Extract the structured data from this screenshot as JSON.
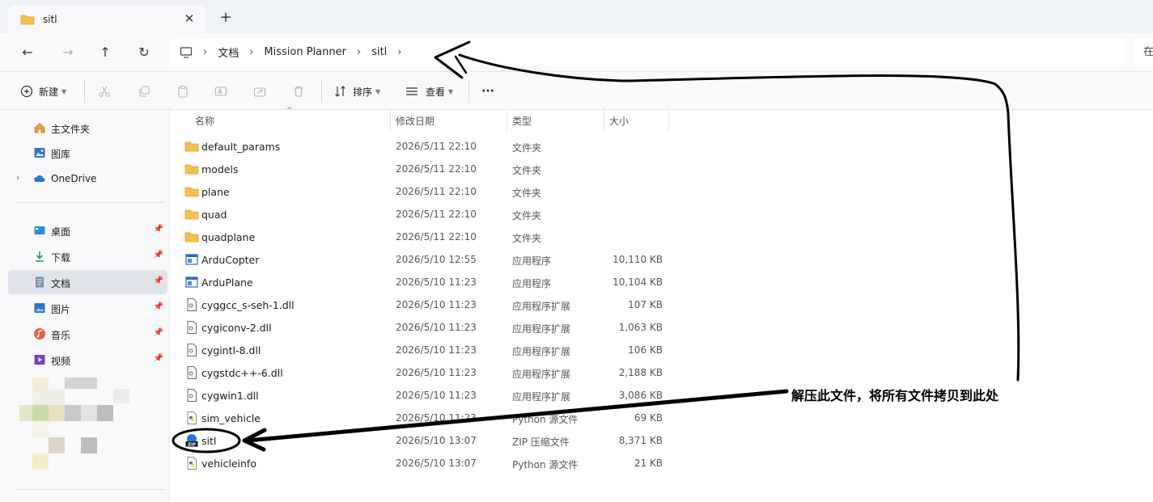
{
  "tab": {
    "title": "sitl",
    "close": "✕",
    "new_tab": "+"
  },
  "nav": {
    "back": "←",
    "forward": "→",
    "up": "↑",
    "refresh": "↻"
  },
  "address": {
    "crumbs": [
      "文档",
      "Mission Planner",
      "sitl"
    ],
    "separator": "›",
    "search_placeholder": "在"
  },
  "toolbar": {
    "new_label": "新建",
    "sort_label": "排序",
    "view_label": "查看",
    "more_label": "···"
  },
  "sidebar": {
    "items": [
      {
        "label": "主文件夹",
        "icon": "home-icon"
      },
      {
        "label": "图库",
        "icon": "gallery-icon"
      },
      {
        "label": "OneDrive",
        "icon": "cloud-icon"
      },
      {
        "label": "桌面",
        "icon": "desktop-icon",
        "pinned": true
      },
      {
        "label": "下载",
        "icon": "download-icon",
        "pinned": true
      },
      {
        "label": "文档",
        "icon": "documents-icon",
        "pinned": true,
        "selected": true
      },
      {
        "label": "图片",
        "icon": "pictures-icon",
        "pinned": true
      },
      {
        "label": "音乐",
        "icon": "music-icon",
        "pinned": true
      },
      {
        "label": "视频",
        "icon": "video-icon",
        "pinned": true
      }
    ]
  },
  "columns": {
    "name": "名称",
    "modified": "修改日期",
    "type": "类型",
    "size": "大小"
  },
  "files": [
    {
      "name": "default_params",
      "modified": "2026/5/11 22:10",
      "type": "文件夹",
      "size": "",
      "icon": "folder-icon"
    },
    {
      "name": "models",
      "modified": "2026/5/11 22:10",
      "type": "文件夹",
      "size": "",
      "icon": "folder-icon"
    },
    {
      "name": "plane",
      "modified": "2026/5/11 22:10",
      "type": "文件夹",
      "size": "",
      "icon": "folder-icon"
    },
    {
      "name": "quad",
      "modified": "2026/5/11 22:10",
      "type": "文件夹",
      "size": "",
      "icon": "folder-icon"
    },
    {
      "name": "quadplane",
      "modified": "2026/5/11 22:10",
      "type": "文件夹",
      "size": "",
      "icon": "folder-icon"
    },
    {
      "name": "ArduCopter",
      "modified": "2026/5/10 12:55",
      "type": "应用程序",
      "size": "10,110 KB",
      "icon": "exe-icon"
    },
    {
      "name": "ArduPlane",
      "modified": "2026/5/10 11:23",
      "type": "应用程序",
      "size": "10,104 KB",
      "icon": "exe-icon"
    },
    {
      "name": "cyggcc_s-seh-1.dll",
      "modified": "2026/5/10 11:23",
      "type": "应用程序扩展",
      "size": "107 KB",
      "icon": "dll-icon"
    },
    {
      "name": "cygiconv-2.dll",
      "modified": "2026/5/10 11:23",
      "type": "应用程序扩展",
      "size": "1,063 KB",
      "icon": "dll-icon"
    },
    {
      "name": "cygintl-8.dll",
      "modified": "2026/5/10 11:23",
      "type": "应用程序扩展",
      "size": "106 KB",
      "icon": "dll-icon"
    },
    {
      "name": "cygstdc++-6.dll",
      "modified": "2026/5/10 11:23",
      "type": "应用程序扩展",
      "size": "2,188 KB",
      "icon": "dll-icon"
    },
    {
      "name": "cygwin1.dll",
      "modified": "2026/5/10 11:23",
      "type": "应用程序扩展",
      "size": "3,086 KB",
      "icon": "dll-icon"
    },
    {
      "name": "sim_vehicle",
      "modified": "2026/5/10 11:23",
      "type": "Python 源文件",
      "size": "69 KB",
      "icon": "python-file-icon"
    },
    {
      "name": "sitl",
      "modified": "2026/5/10 13:07",
      "type": "ZIP 压缩文件",
      "size": "8,371 KB",
      "icon": "zip-icon"
    },
    {
      "name": "vehicleinfo",
      "modified": "2026/5/10 13:07",
      "type": "Python 源文件",
      "size": "21 KB",
      "icon": "python-file-icon"
    }
  ],
  "annotation": {
    "text": "解压此文件，将所有文件拷贝到此处"
  },
  "colors": {
    "folder": "#f2c14e",
    "accent": "#0067c0",
    "selected_bg": "#e0e4ea"
  }
}
